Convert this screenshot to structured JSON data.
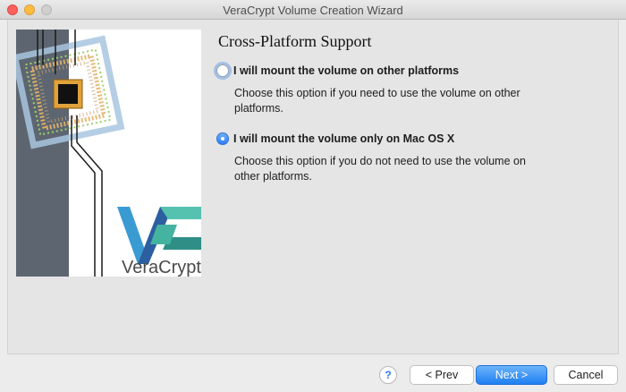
{
  "window": {
    "title": "VeraCrypt Volume Creation Wizard"
  },
  "sidebar_image": {
    "logo_text": "VeraCrypt"
  },
  "page": {
    "heading": "Cross-Platform Support",
    "options": [
      {
        "label": "I will mount the volume on other platforms",
        "description": "Choose this option if you need to use the volume on other platforms.",
        "selected": false
      },
      {
        "label": "I will mount the volume only on Mac OS X",
        "description": "Choose this option if you do not need to use the volume on other platforms.",
        "selected": true
      }
    ]
  },
  "buttons": {
    "help": "?",
    "prev": "< Prev",
    "next": "Next >",
    "cancel": "Cancel"
  }
}
